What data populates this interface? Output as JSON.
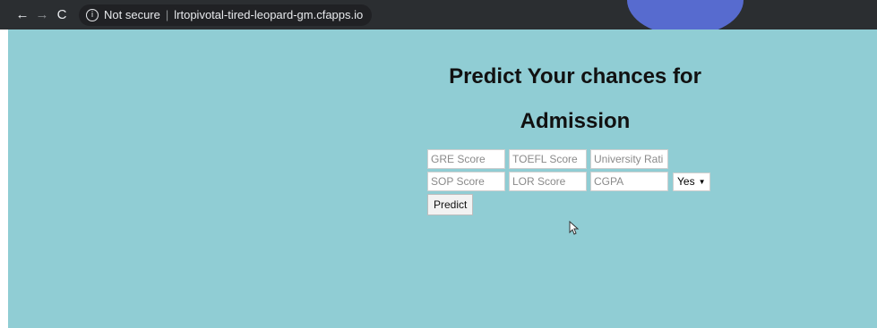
{
  "browser": {
    "back_icon": "arrow-left-icon",
    "forward_icon": "arrow-right-icon",
    "reload_icon": "reload-icon",
    "security_label": "Not secure",
    "url": "lrtopivotal-tired-leopard-gm.cfapps.io"
  },
  "page": {
    "title_line1": "Predict Your chances for",
    "title_line2": "Admission",
    "form": {
      "gre_placeholder": "GRE Score",
      "toefl_placeholder": "TOEFL Score",
      "university_placeholder": "University Rati",
      "sop_placeholder": "SOP Score",
      "lor_placeholder": "LOR Score",
      "cgpa_placeholder": "CGPA",
      "research_selected": "Yes",
      "predict_label": "Predict"
    }
  },
  "colors": {
    "page_background": "#90cdd4",
    "chrome_background": "#2b2e31"
  }
}
